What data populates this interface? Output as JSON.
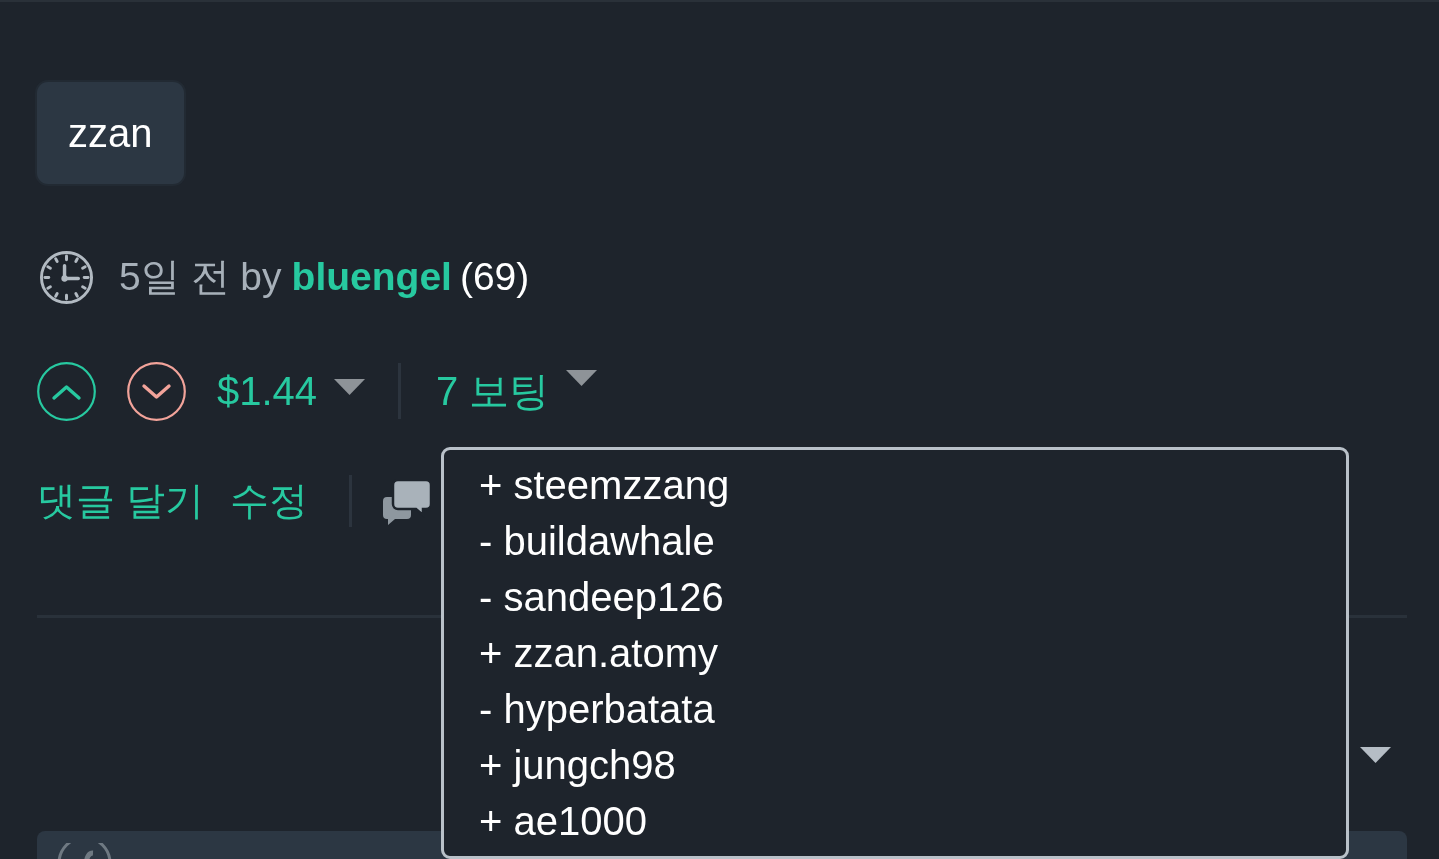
{
  "tag": {
    "label": "zzan"
  },
  "meta": {
    "posted": "5일 전 by",
    "author": "bluengel",
    "reputation": "(69)"
  },
  "votes": {
    "payout": "$1.44",
    "voter_count": "7 보팅"
  },
  "actions": [
    {
      "label": "댓글 달기"
    },
    {
      "label": "수정"
    }
  ],
  "voters_menu": {
    "open": true,
    "items": [
      {
        "label": "+ steemzzang"
      },
      {
        "label": "- buildawhale"
      },
      {
        "label": "- sandeep126"
      },
      {
        "label": "+ zzan.atomy"
      },
      {
        "label": "- hyperbatata"
      },
      {
        "label": "+ jungch98"
      },
      {
        "label": "+ ae1000"
      }
    ]
  }
}
